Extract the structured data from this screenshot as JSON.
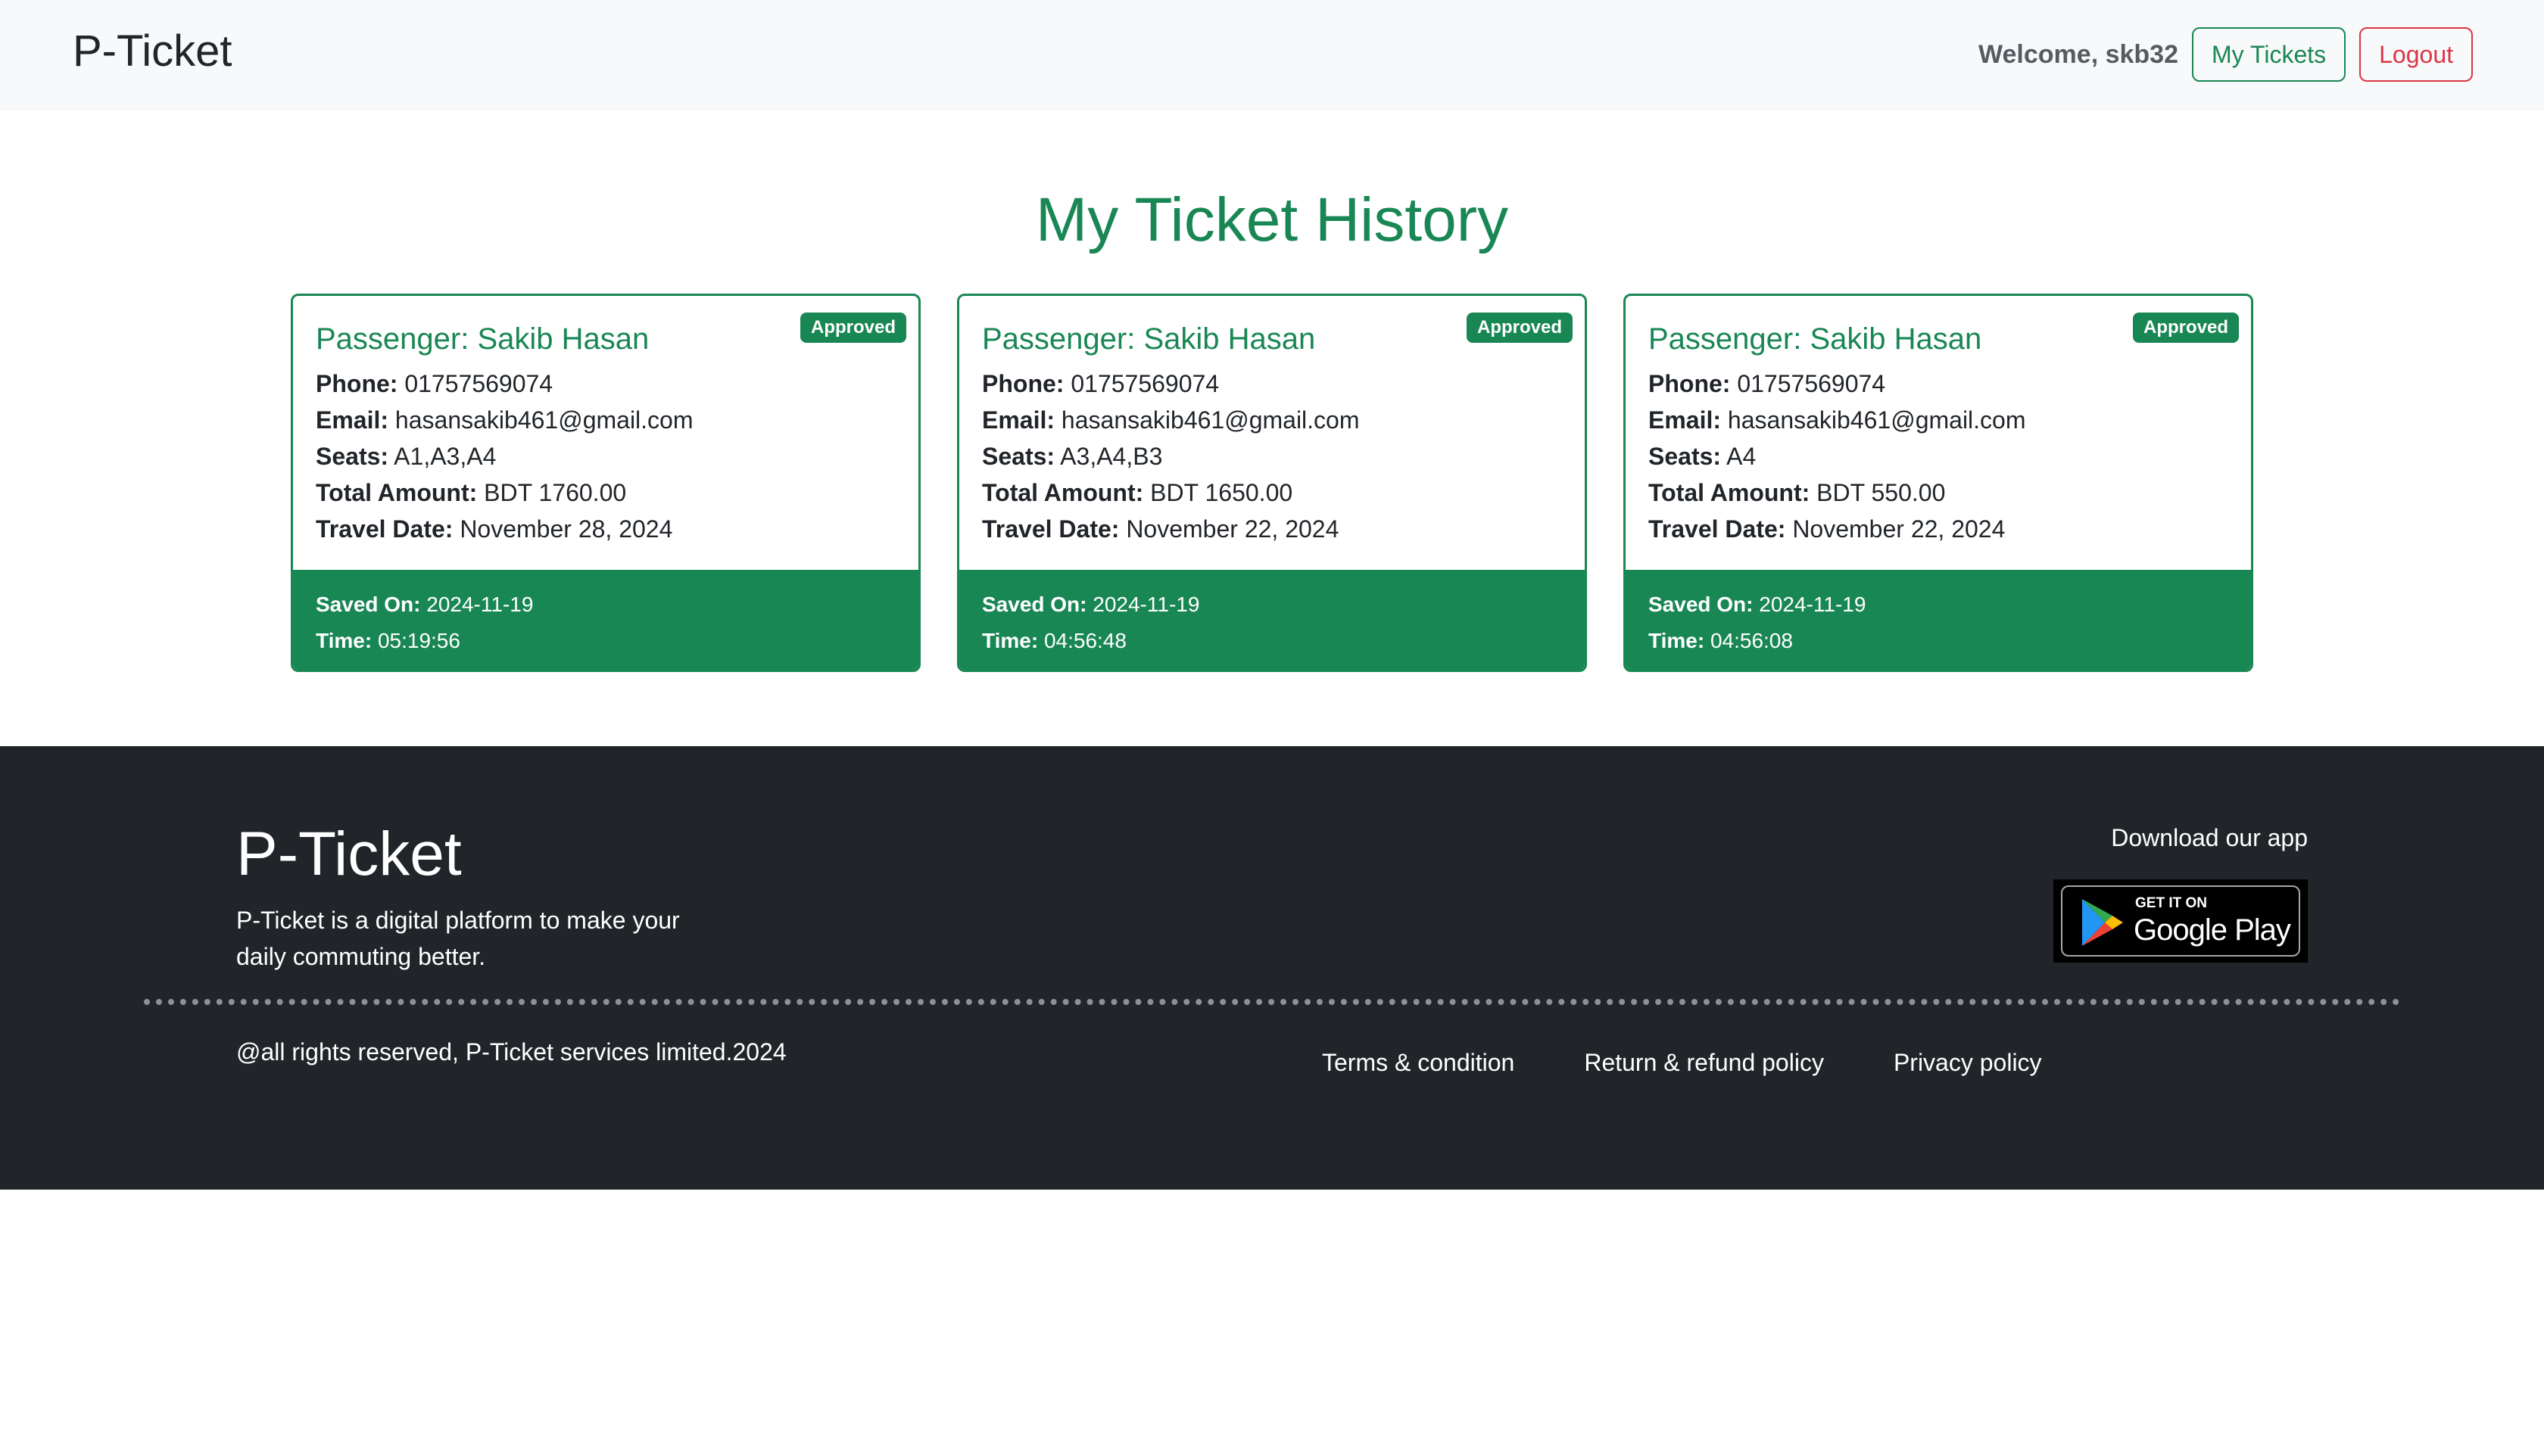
{
  "navbar": {
    "brand": "P-Ticket",
    "welcome": "Welcome, skb32",
    "my_tickets_label": "My Tickets",
    "logout_label": "Logout"
  },
  "main": {
    "title": "My Ticket History",
    "labels": {
      "phone": "Phone:",
      "email": "Email:",
      "seats": "Seats:",
      "total_amount": "Total Amount:",
      "travel_date": "Travel Date:",
      "saved_on": "Saved On:",
      "time": "Time:"
    },
    "tickets": [
      {
        "status": "Approved",
        "passenger": "Passenger: Sakib Hasan",
        "phone": "01757569074",
        "email": "hasansakib461@gmail.com",
        "seats": "A1,A3,A4",
        "total_amount": "BDT 1760.00",
        "travel_date": "November 28, 2024",
        "saved_on": "2024-11-19",
        "time": "05:19:56"
      },
      {
        "status": "Approved",
        "passenger": "Passenger: Sakib Hasan",
        "phone": "01757569074",
        "email": "hasansakib461@gmail.com",
        "seats": "A3,A4,B3",
        "total_amount": "BDT 1650.00",
        "travel_date": "November 22, 2024",
        "saved_on": "2024-11-19",
        "time": "04:56:48"
      },
      {
        "status": "Approved",
        "passenger": "Passenger: Sakib Hasan",
        "phone": "01757569074",
        "email": "hasansakib461@gmail.com",
        "seats": "A4",
        "total_amount": "BDT 550.00",
        "travel_date": "November 22, 2024",
        "saved_on": "2024-11-19",
        "time": "04:56:08"
      }
    ]
  },
  "footer": {
    "brand": "P-Ticket",
    "tagline": "P-Ticket is a digital platform to make your daily commuting better.",
    "download_text": "Download our app",
    "google_play": {
      "small": "GET IT ON",
      "big": "Google Play",
      "icon": "google-play-icon"
    },
    "copyright": "@all rights reserved, P-Ticket services limited.2024",
    "links": [
      "Terms & condition",
      "Return & refund policy",
      "Privacy policy"
    ]
  },
  "colors": {
    "brand_green": "#198754",
    "danger_red": "#dc3545",
    "footer_bg": "#212529",
    "navbar_bg": "#f8f9fa"
  }
}
